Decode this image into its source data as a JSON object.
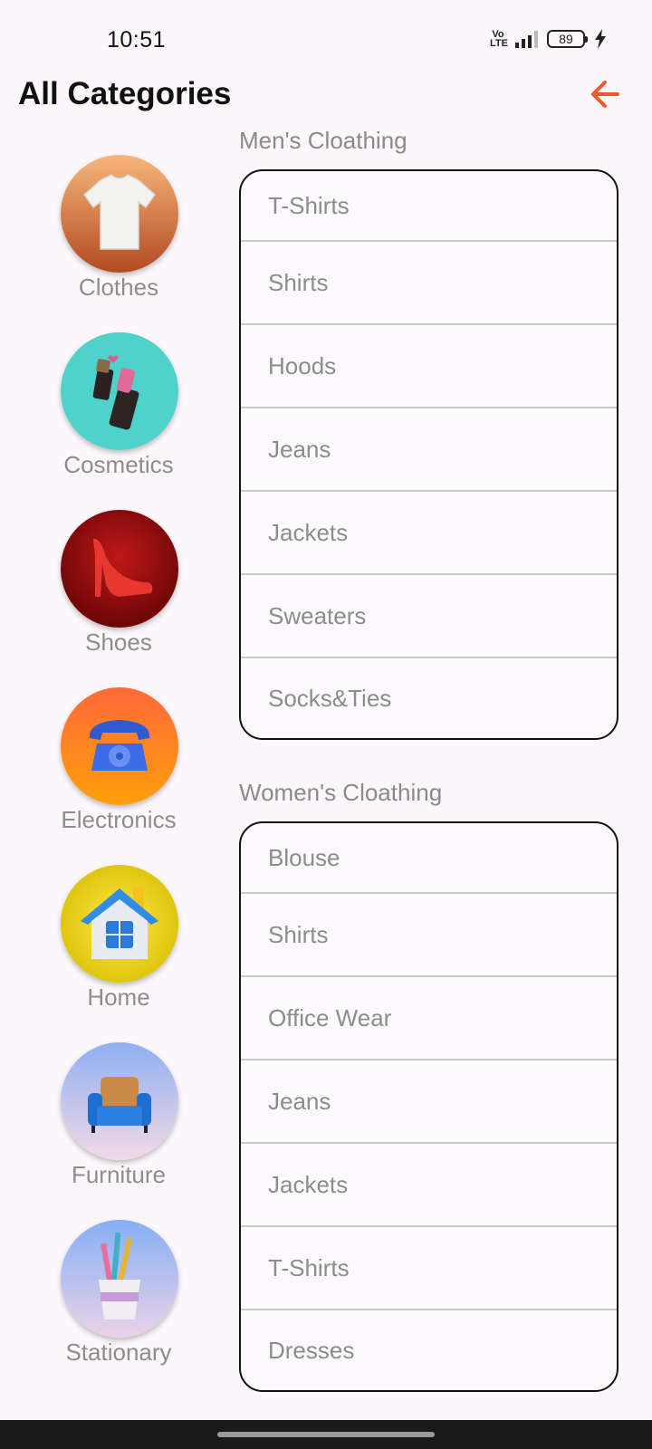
{
  "status_bar": {
    "time": "10:51",
    "network": "Vo LTE",
    "battery_level": "89"
  },
  "header": {
    "title": "All Categories",
    "back_icon": "arrow-left-icon",
    "accent_color": "#f0592a"
  },
  "categories": [
    {
      "label": "Clothes",
      "icon": "tshirt-icon"
    },
    {
      "label": "Cosmetics",
      "icon": "lipstick-icon"
    },
    {
      "label": "Shoes",
      "icon": "high-heel-icon"
    },
    {
      "label": "Electronics",
      "icon": "telephone-icon"
    },
    {
      "label": "Home",
      "icon": "house-icon"
    },
    {
      "label": "Furniture",
      "icon": "armchair-icon"
    },
    {
      "label": "Stationary",
      "icon": "pencil-cup-icon"
    }
  ],
  "sections": [
    {
      "title": "Men's Cloathing",
      "items": [
        "T-Shirts",
        "Shirts",
        "Hoods",
        "Jeans",
        "Jackets",
        "Sweaters",
        "Socks&Ties"
      ]
    },
    {
      "title": "Women's Cloathing",
      "items": [
        "Blouse",
        "Shirts",
        "Office Wear",
        "Jeans",
        "Jackets",
        "T-Shirts",
        "Dresses"
      ]
    }
  ]
}
